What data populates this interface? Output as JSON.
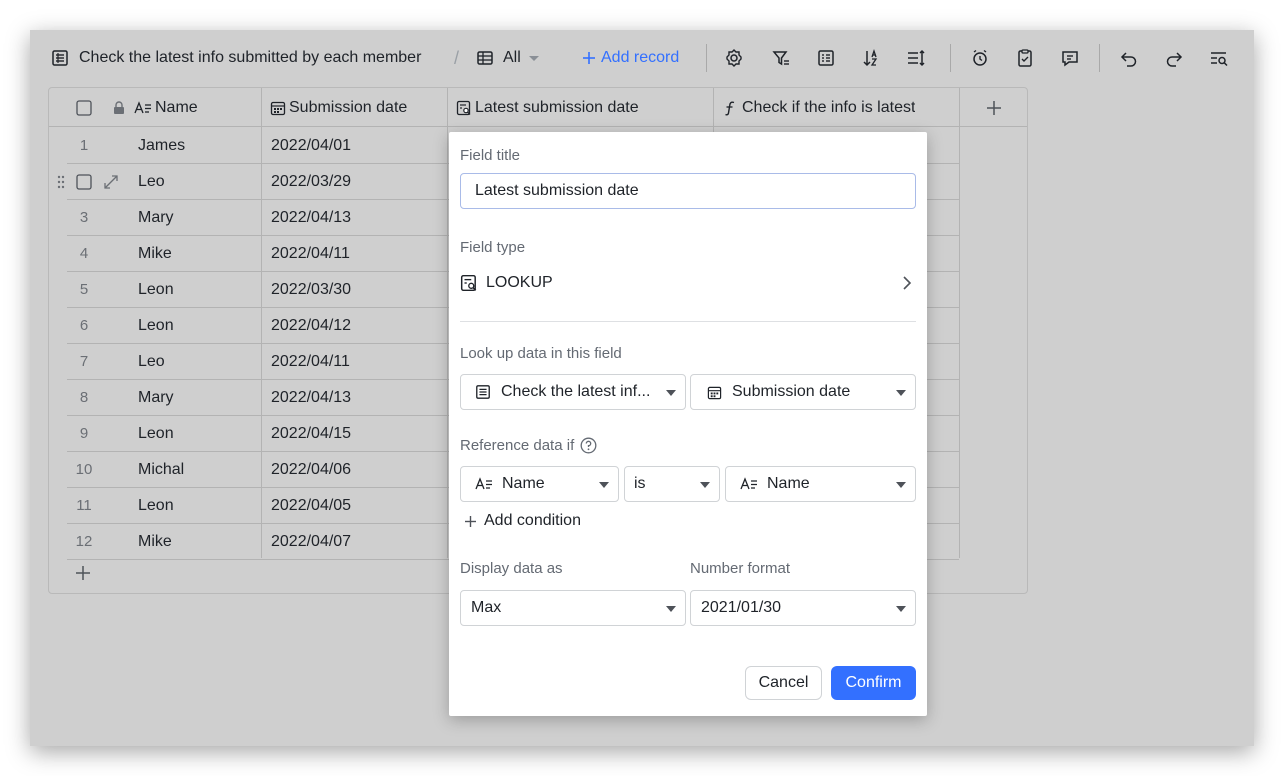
{
  "toolbar": {
    "title": "Check the latest info submitted by each member",
    "separator": "/",
    "view_label": "All",
    "add_record_label": "Add record",
    "icons": [
      "settings-icon",
      "filter-icon",
      "group-icon",
      "sort-icon",
      "row-height-icon",
      "automation-icon",
      "form-icon",
      "comment-icon",
      "undo-icon",
      "redo-icon",
      "search-icon"
    ]
  },
  "grid": {
    "columns": [
      {
        "name": "Name",
        "icon": "text-field-icon"
      },
      {
        "name": "Submission date",
        "icon": "date-field-icon"
      },
      {
        "name": "Latest submission date",
        "icon": "lookup-field-icon"
      },
      {
        "name": "Check if the info is latest",
        "icon": "formula-field-icon"
      }
    ],
    "rows": [
      {
        "num": "1",
        "name": "James",
        "date": "2022/04/01"
      },
      {
        "num": "",
        "name": "Leo",
        "date": "2022/03/29"
      },
      {
        "num": "3",
        "name": "Mary",
        "date": "2022/04/13"
      },
      {
        "num": "4",
        "name": "Mike",
        "date": "2022/04/11"
      },
      {
        "num": "5",
        "name": "Leon",
        "date": "2022/03/30"
      },
      {
        "num": "6",
        "name": "Leon",
        "date": "2022/04/12"
      },
      {
        "num": "7",
        "name": "Leo",
        "date": "2022/04/11"
      },
      {
        "num": "8",
        "name": "Mary",
        "date": "2022/04/13"
      },
      {
        "num": "9",
        "name": "Leon",
        "date": "2022/04/15"
      },
      {
        "num": "10",
        "name": "Michal",
        "date": "2022/04/06"
      },
      {
        "num": "11",
        "name": "Leon",
        "date": "2022/04/05"
      },
      {
        "num": "12",
        "name": "Mike",
        "date": "2022/04/07"
      }
    ]
  },
  "dialog": {
    "field_title_label": "Field title",
    "field_title_value": "Latest submission date",
    "field_type_label": "Field type",
    "field_type_value": "LOOKUP",
    "lookup_label": "Look up data in this field",
    "lookup_table": "Check the latest inf...",
    "lookup_field": "Submission date",
    "reference_label": "Reference data if",
    "condition_left": "Name",
    "condition_op": "is",
    "condition_right": "Name",
    "add_condition_label": "Add condition",
    "display_label": "Display data as",
    "display_value": "Max",
    "number_format_label": "Number format",
    "number_format_value": "2021/01/30",
    "cancel_label": "Cancel",
    "confirm_label": "Confirm"
  },
  "colors": {
    "accent": "#3370ff",
    "backdrop": "#cfcfcf",
    "dialog": "#ffffff"
  }
}
